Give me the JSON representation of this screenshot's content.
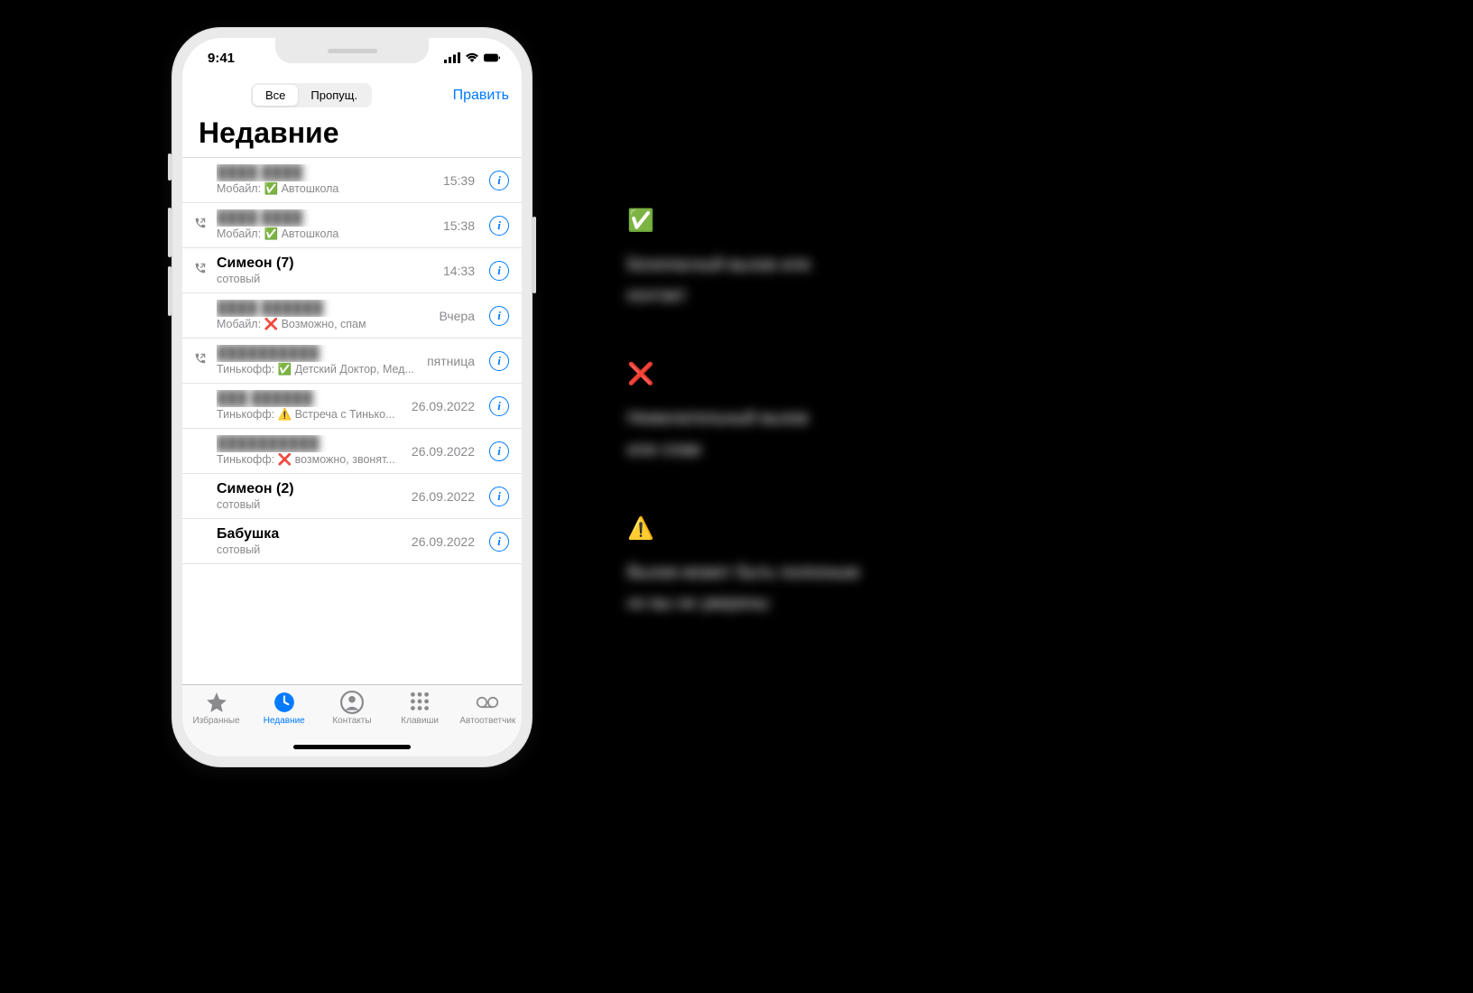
{
  "status_bar": {
    "time": "9:41"
  },
  "nav": {
    "seg_all": "Все",
    "seg_missed": "Пропущ.",
    "edit": "Править"
  },
  "title": "Недавние",
  "rows": [
    {
      "name": "████ ████",
      "blurred": true,
      "outgoing": false,
      "sub_prefix": "Мобайл: ",
      "sub_emoji": "✅",
      "sub_text": " Автошкола",
      "time": "15:39"
    },
    {
      "name": "████ ████",
      "blurred": true,
      "outgoing": true,
      "sub_prefix": "Мобайл: ",
      "sub_emoji": "✅",
      "sub_text": " Автошкола",
      "time": "15:38"
    },
    {
      "name": "Симеон (7)",
      "blurred": false,
      "outgoing": true,
      "sub_prefix": "сотовый",
      "sub_emoji": "",
      "sub_text": "",
      "time": "14:33"
    },
    {
      "name": "████ ██████",
      "blurred": true,
      "outgoing": false,
      "sub_prefix": "Мобайл: ",
      "sub_emoji": "❌",
      "sub_text": " Возможно, спам",
      "time": "Вчера"
    },
    {
      "name": "██████████",
      "blurred": true,
      "outgoing": true,
      "sub_prefix": "Тинькофф: ",
      "sub_emoji": "✅",
      "sub_text": " Детский Доктор, Мед...",
      "time": "пятница"
    },
    {
      "name": "███ ██████",
      "blurred": true,
      "outgoing": false,
      "sub_prefix": "Тинькофф: ",
      "sub_emoji": "⚠️",
      "sub_text": " Встреча с Тинько...",
      "time": "26.09.2022"
    },
    {
      "name": "██████████",
      "blurred": true,
      "outgoing": false,
      "sub_prefix": "Тинькофф: ",
      "sub_emoji": "❌",
      "sub_text": " возможно, звонят...",
      "time": "26.09.2022"
    },
    {
      "name": "Симеон (2)",
      "blurred": false,
      "outgoing": false,
      "sub_prefix": "сотовый",
      "sub_emoji": "",
      "sub_text": "",
      "time": "26.09.2022"
    },
    {
      "name": "Бабушка",
      "blurred": false,
      "outgoing": false,
      "sub_prefix": "сотовый",
      "sub_emoji": "",
      "sub_text": "",
      "time": "26.09.2022"
    }
  ],
  "tabs": {
    "favorites": "Избранные",
    "recents": "Недавние",
    "contacts": "Контакты",
    "keypad": "Клавиши",
    "voicemail": "Автоответчик"
  },
  "legend": [
    {
      "emoji": "✅",
      "text1": "Безопасный вызов или",
      "text2": "контакт"
    },
    {
      "emoji": "❌",
      "text1": "Нежелательный вызов",
      "text2": "или спам"
    },
    {
      "emoji": "⚠️",
      "text1": "Вызов может быть полезным",
      "text2": "но вы не уверены"
    }
  ]
}
